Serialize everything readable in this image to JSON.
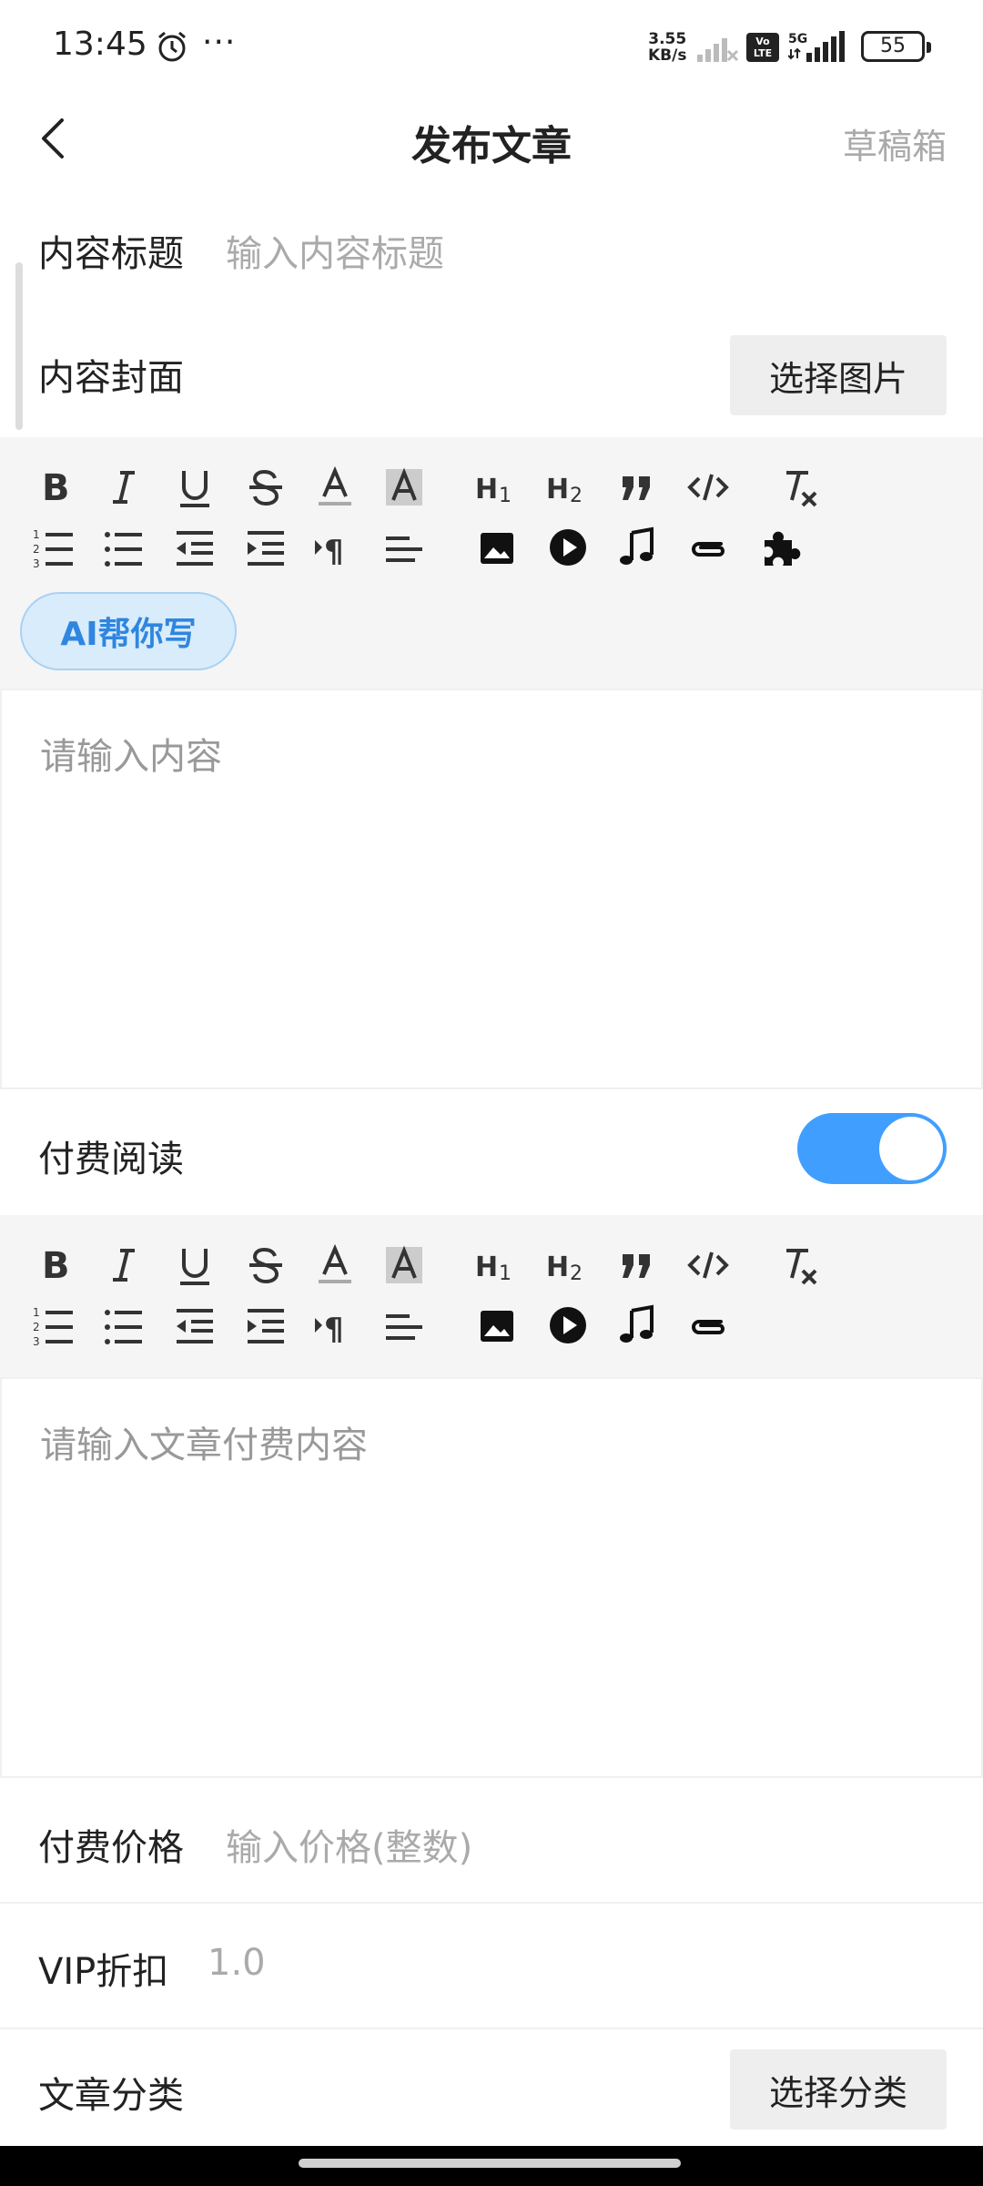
{
  "status": {
    "time": "13:45",
    "dots": "···",
    "speed_value": "3.55",
    "speed_unit": "KB/s",
    "volte_top": "Vo",
    "volte_bottom": "LTE",
    "network": "5G",
    "battery": "55"
  },
  "header": {
    "title": "发布文章",
    "drafts": "草稿箱"
  },
  "form": {
    "title_label": "内容标题",
    "title_placeholder": "输入内容标题",
    "cover_label": "内容封面",
    "cover_button": "选择图片",
    "ai_button": "AI帮你写",
    "content_placeholder": "请输入内容",
    "paid_label": "付费阅读",
    "paid_enabled": true,
    "paid_content_placeholder": "请输入文章付费内容",
    "price_label": "付费价格",
    "price_placeholder": "输入价格(整数)",
    "vip_label": "VIP折扣",
    "vip_value": "1.0",
    "category_label": "文章分类",
    "category_button": "选择分类"
  },
  "toolbar_icons": {
    "row1": [
      "bold-icon",
      "italic-icon",
      "underline-icon",
      "strikethrough-icon",
      "font-color-icon",
      "highlight-icon",
      "heading1-icon",
      "heading2-icon",
      "quote-icon",
      "code-icon",
      "clear-format-icon"
    ],
    "row2": [
      "ordered-list-icon",
      "bullet-list-icon",
      "outdent-icon",
      "indent-icon",
      "paragraph-direction-icon",
      "align-left-icon",
      "image-icon",
      "video-icon",
      "audio-icon",
      "attachment-icon",
      "plugin-icon"
    ]
  },
  "colors": {
    "accent": "#409eff",
    "ai_text": "#2f86e0",
    "toolbar_bg": "#f5f5f5"
  }
}
